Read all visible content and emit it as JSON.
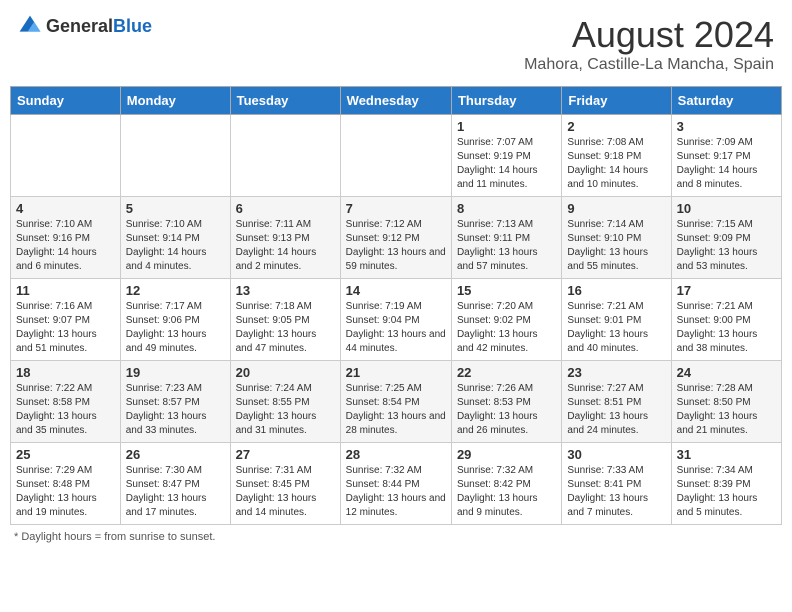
{
  "header": {
    "logo_general": "General",
    "logo_blue": "Blue",
    "title": "August 2024",
    "location": "Mahora, Castille-La Mancha, Spain"
  },
  "weekdays": [
    "Sunday",
    "Monday",
    "Tuesday",
    "Wednesday",
    "Thursday",
    "Friday",
    "Saturday"
  ],
  "footer": {
    "note": "Daylight hours"
  },
  "weeks": [
    [
      {
        "day": "",
        "sunrise": "",
        "sunset": "",
        "daylight": ""
      },
      {
        "day": "",
        "sunrise": "",
        "sunset": "",
        "daylight": ""
      },
      {
        "day": "",
        "sunrise": "",
        "sunset": "",
        "daylight": ""
      },
      {
        "day": "",
        "sunrise": "",
        "sunset": "",
        "daylight": ""
      },
      {
        "day": "1",
        "sunrise": "Sunrise: 7:07 AM",
        "sunset": "Sunset: 9:19 PM",
        "daylight": "Daylight: 14 hours and 11 minutes."
      },
      {
        "day": "2",
        "sunrise": "Sunrise: 7:08 AM",
        "sunset": "Sunset: 9:18 PM",
        "daylight": "Daylight: 14 hours and 10 minutes."
      },
      {
        "day": "3",
        "sunrise": "Sunrise: 7:09 AM",
        "sunset": "Sunset: 9:17 PM",
        "daylight": "Daylight: 14 hours and 8 minutes."
      }
    ],
    [
      {
        "day": "4",
        "sunrise": "Sunrise: 7:10 AM",
        "sunset": "Sunset: 9:16 PM",
        "daylight": "Daylight: 14 hours and 6 minutes."
      },
      {
        "day": "5",
        "sunrise": "Sunrise: 7:10 AM",
        "sunset": "Sunset: 9:14 PM",
        "daylight": "Daylight: 14 hours and 4 minutes."
      },
      {
        "day": "6",
        "sunrise": "Sunrise: 7:11 AM",
        "sunset": "Sunset: 9:13 PM",
        "daylight": "Daylight: 14 hours and 2 minutes."
      },
      {
        "day": "7",
        "sunrise": "Sunrise: 7:12 AM",
        "sunset": "Sunset: 9:12 PM",
        "daylight": "Daylight: 13 hours and 59 minutes."
      },
      {
        "day": "8",
        "sunrise": "Sunrise: 7:13 AM",
        "sunset": "Sunset: 9:11 PM",
        "daylight": "Daylight: 13 hours and 57 minutes."
      },
      {
        "day": "9",
        "sunrise": "Sunrise: 7:14 AM",
        "sunset": "Sunset: 9:10 PM",
        "daylight": "Daylight: 13 hours and 55 minutes."
      },
      {
        "day": "10",
        "sunrise": "Sunrise: 7:15 AM",
        "sunset": "Sunset: 9:09 PM",
        "daylight": "Daylight: 13 hours and 53 minutes."
      }
    ],
    [
      {
        "day": "11",
        "sunrise": "Sunrise: 7:16 AM",
        "sunset": "Sunset: 9:07 PM",
        "daylight": "Daylight: 13 hours and 51 minutes."
      },
      {
        "day": "12",
        "sunrise": "Sunrise: 7:17 AM",
        "sunset": "Sunset: 9:06 PM",
        "daylight": "Daylight: 13 hours and 49 minutes."
      },
      {
        "day": "13",
        "sunrise": "Sunrise: 7:18 AM",
        "sunset": "Sunset: 9:05 PM",
        "daylight": "Daylight: 13 hours and 47 minutes."
      },
      {
        "day": "14",
        "sunrise": "Sunrise: 7:19 AM",
        "sunset": "Sunset: 9:04 PM",
        "daylight": "Daylight: 13 hours and 44 minutes."
      },
      {
        "day": "15",
        "sunrise": "Sunrise: 7:20 AM",
        "sunset": "Sunset: 9:02 PM",
        "daylight": "Daylight: 13 hours and 42 minutes."
      },
      {
        "day": "16",
        "sunrise": "Sunrise: 7:21 AM",
        "sunset": "Sunset: 9:01 PM",
        "daylight": "Daylight: 13 hours and 40 minutes."
      },
      {
        "day": "17",
        "sunrise": "Sunrise: 7:21 AM",
        "sunset": "Sunset: 9:00 PM",
        "daylight": "Daylight: 13 hours and 38 minutes."
      }
    ],
    [
      {
        "day": "18",
        "sunrise": "Sunrise: 7:22 AM",
        "sunset": "Sunset: 8:58 PM",
        "daylight": "Daylight: 13 hours and 35 minutes."
      },
      {
        "day": "19",
        "sunrise": "Sunrise: 7:23 AM",
        "sunset": "Sunset: 8:57 PM",
        "daylight": "Daylight: 13 hours and 33 minutes."
      },
      {
        "day": "20",
        "sunrise": "Sunrise: 7:24 AM",
        "sunset": "Sunset: 8:55 PM",
        "daylight": "Daylight: 13 hours and 31 minutes."
      },
      {
        "day": "21",
        "sunrise": "Sunrise: 7:25 AM",
        "sunset": "Sunset: 8:54 PM",
        "daylight": "Daylight: 13 hours and 28 minutes."
      },
      {
        "day": "22",
        "sunrise": "Sunrise: 7:26 AM",
        "sunset": "Sunset: 8:53 PM",
        "daylight": "Daylight: 13 hours and 26 minutes."
      },
      {
        "day": "23",
        "sunrise": "Sunrise: 7:27 AM",
        "sunset": "Sunset: 8:51 PM",
        "daylight": "Daylight: 13 hours and 24 minutes."
      },
      {
        "day": "24",
        "sunrise": "Sunrise: 7:28 AM",
        "sunset": "Sunset: 8:50 PM",
        "daylight": "Daylight: 13 hours and 21 minutes."
      }
    ],
    [
      {
        "day": "25",
        "sunrise": "Sunrise: 7:29 AM",
        "sunset": "Sunset: 8:48 PM",
        "daylight": "Daylight: 13 hours and 19 minutes."
      },
      {
        "day": "26",
        "sunrise": "Sunrise: 7:30 AM",
        "sunset": "Sunset: 8:47 PM",
        "daylight": "Daylight: 13 hours and 17 minutes."
      },
      {
        "day": "27",
        "sunrise": "Sunrise: 7:31 AM",
        "sunset": "Sunset: 8:45 PM",
        "daylight": "Daylight: 13 hours and 14 minutes."
      },
      {
        "day": "28",
        "sunrise": "Sunrise: 7:32 AM",
        "sunset": "Sunset: 8:44 PM",
        "daylight": "Daylight: 13 hours and 12 minutes."
      },
      {
        "day": "29",
        "sunrise": "Sunrise: 7:32 AM",
        "sunset": "Sunset: 8:42 PM",
        "daylight": "Daylight: 13 hours and 9 minutes."
      },
      {
        "day": "30",
        "sunrise": "Sunrise: 7:33 AM",
        "sunset": "Sunset: 8:41 PM",
        "daylight": "Daylight: 13 hours and 7 minutes."
      },
      {
        "day": "31",
        "sunrise": "Sunrise: 7:34 AM",
        "sunset": "Sunset: 8:39 PM",
        "daylight": "Daylight: 13 hours and 5 minutes."
      }
    ]
  ]
}
